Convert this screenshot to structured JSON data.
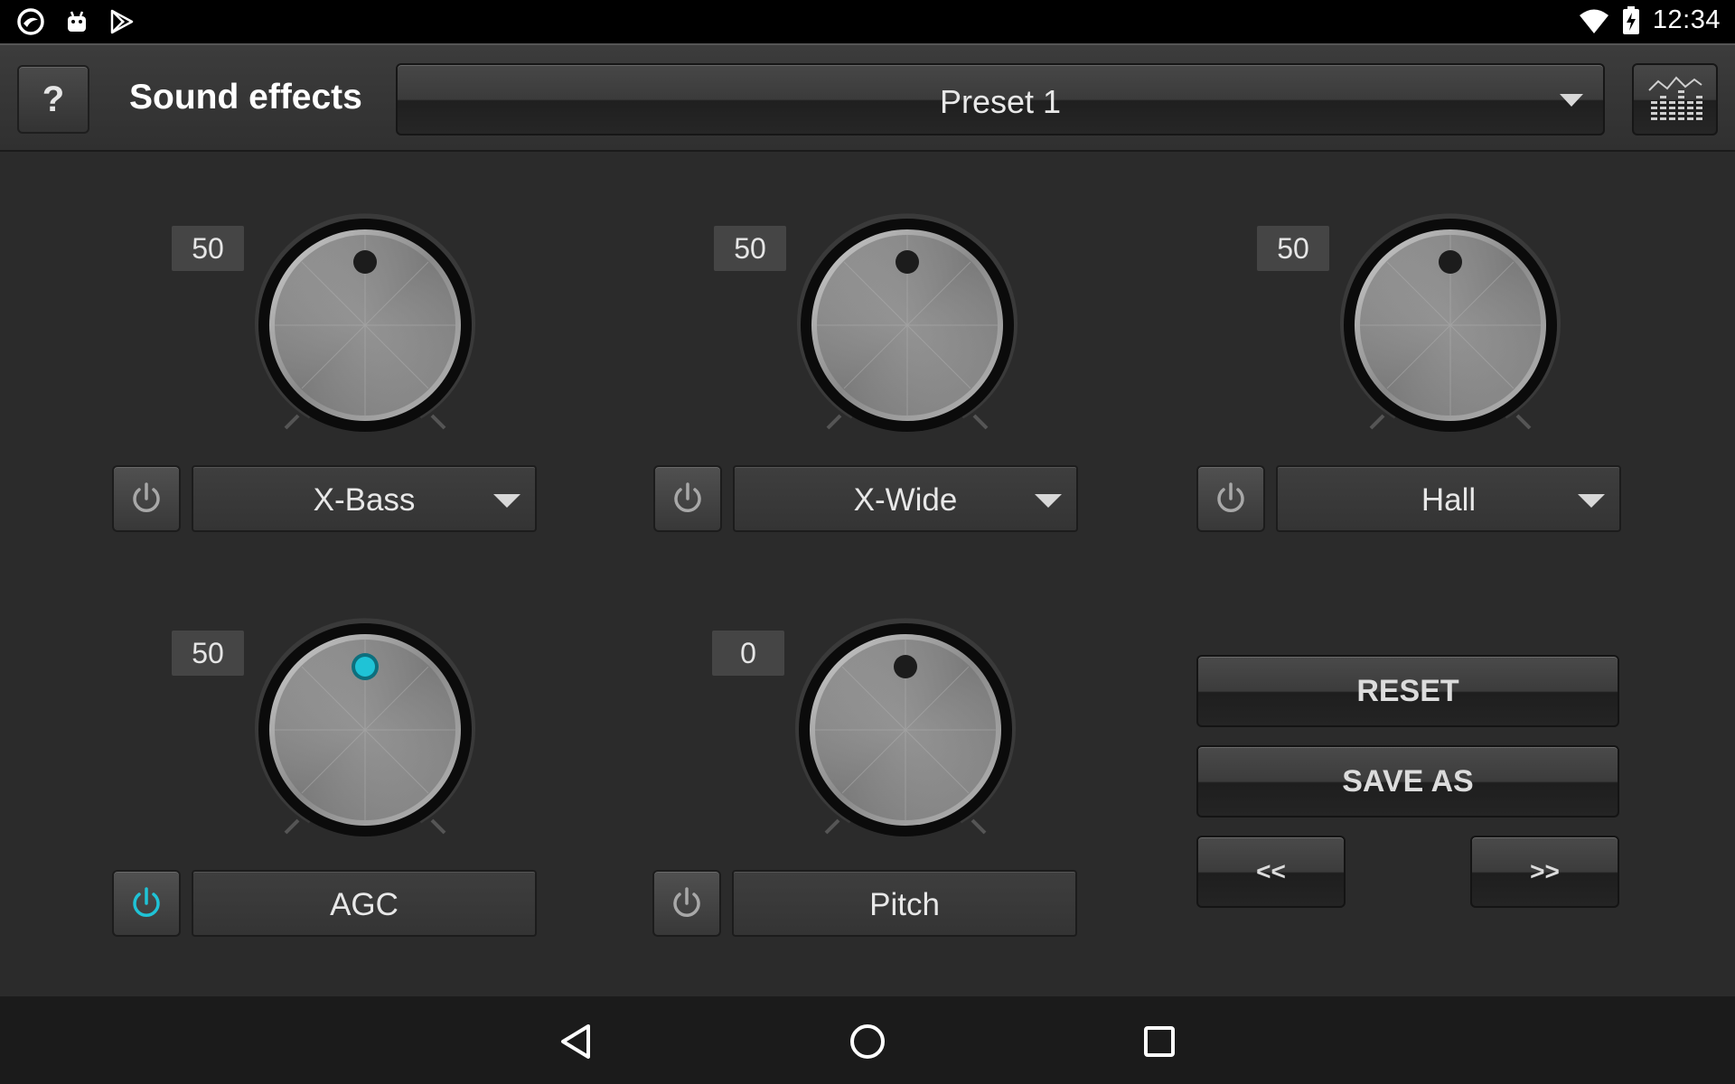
{
  "status_bar": {
    "time": "12:34",
    "left_icons": [
      "app-swirl-icon",
      "android-icon",
      "play-store-icon"
    ],
    "right_icons": [
      "wifi-icon",
      "battery-charging-icon"
    ]
  },
  "toolbar": {
    "help_label": "?",
    "title": "Sound effects",
    "preset": "Preset 1"
  },
  "effects": [
    {
      "id": "x-bass",
      "value": "50",
      "label": "X-Bass",
      "has_dropdown": true,
      "enabled": false
    },
    {
      "id": "x-wide",
      "value": "50",
      "label": "X-Wide",
      "has_dropdown": true,
      "enabled": false
    },
    {
      "id": "hall",
      "value": "50",
      "label": "Hall",
      "has_dropdown": true,
      "enabled": false
    },
    {
      "id": "agc",
      "value": "50",
      "label": "AGC",
      "has_dropdown": false,
      "enabled": true
    },
    {
      "id": "pitch",
      "value": "0",
      "label": "Pitch",
      "has_dropdown": false,
      "enabled": false
    }
  ],
  "actions": {
    "reset": "RESET",
    "save_as": "SAVE AS",
    "prev": "<<",
    "next": ">>"
  },
  "colors": {
    "accent": "#1fc3d6",
    "inactive_icon": "#a8a8a8"
  }
}
